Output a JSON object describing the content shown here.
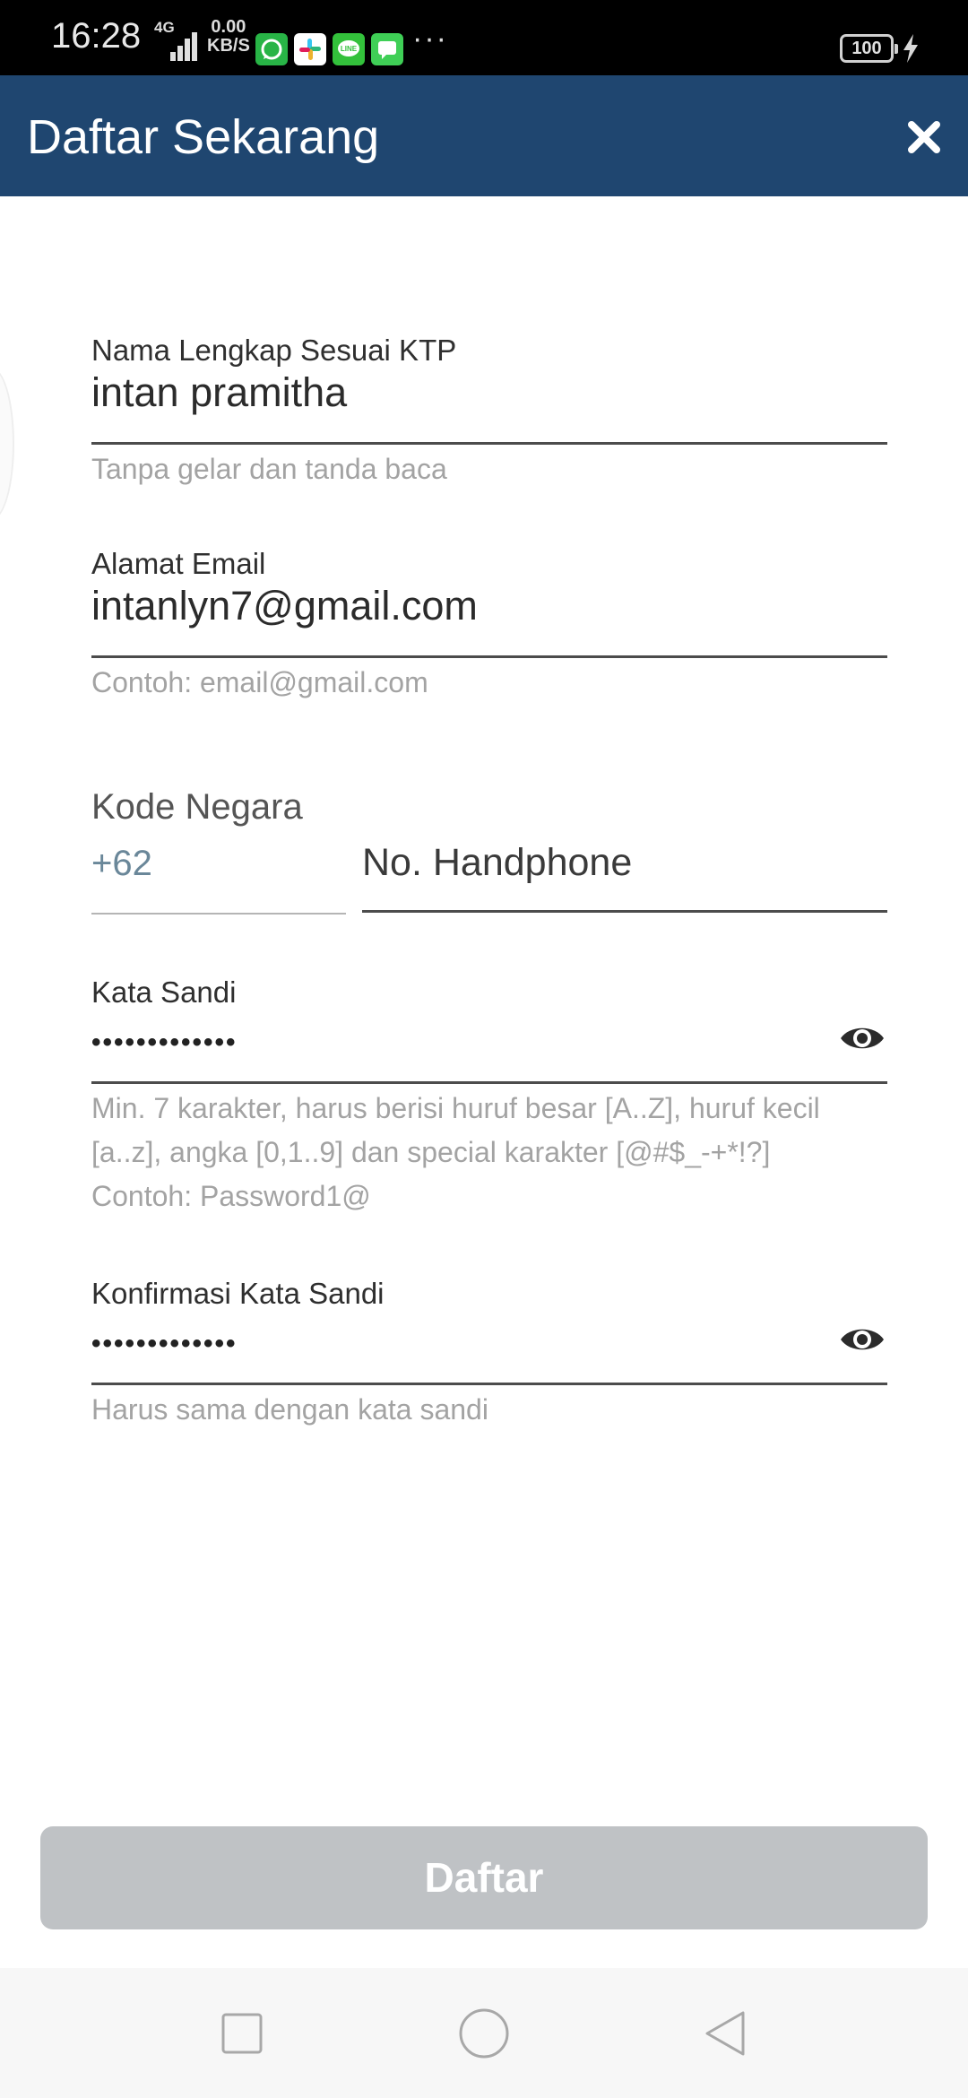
{
  "status_bar": {
    "time": "16:28",
    "network_type": "4G",
    "speed_value": "0.00",
    "speed_unit": "KB/S",
    "more_indicator": "···",
    "battery_level": "100",
    "notification_icons": [
      "whatsapp-icon",
      "slack-icon",
      "line-icon",
      "messages-icon"
    ]
  },
  "header": {
    "title": "Daftar Sekarang",
    "close_icon": "close-icon",
    "background_color": "#1f4670"
  },
  "form": {
    "full_name": {
      "label": "Nama Lengkap Sesuai KTP",
      "value": "intan pramitha",
      "helper": "Tanpa gelar dan tanda baca"
    },
    "email": {
      "label": "Alamat Email",
      "value": "intanlyn7@gmail.com",
      "helper": "Contoh: email@gmail.com"
    },
    "country_code": {
      "label": "Kode Negara",
      "value": "+62"
    },
    "phone": {
      "placeholder": "No. Handphone",
      "value": ""
    },
    "password": {
      "label": "Kata Sandi",
      "masked_value": "•••••••••••••",
      "helper_line1": "Min. 7 karakter, harus berisi huruf besar [A..Z], huruf kecil",
      "helper_line2": "[a..z], angka [0,1..9] dan special karakter [@#$_-+*!?]",
      "helper_line3": "Contoh: Password1@",
      "toggle_icon": "eye-icon"
    },
    "confirm_password": {
      "label": "Konfirmasi Kata Sandi",
      "masked_value": "•••••••••••••",
      "helper": "Harus sama dengan kata sandi",
      "toggle_icon": "eye-icon"
    }
  },
  "submit": {
    "label": "Daftar",
    "state": "disabled",
    "color": "#bfc2c5"
  },
  "nav_bar": {
    "buttons": [
      "recents-square-icon",
      "home-circle-icon",
      "back-triangle-icon"
    ]
  }
}
